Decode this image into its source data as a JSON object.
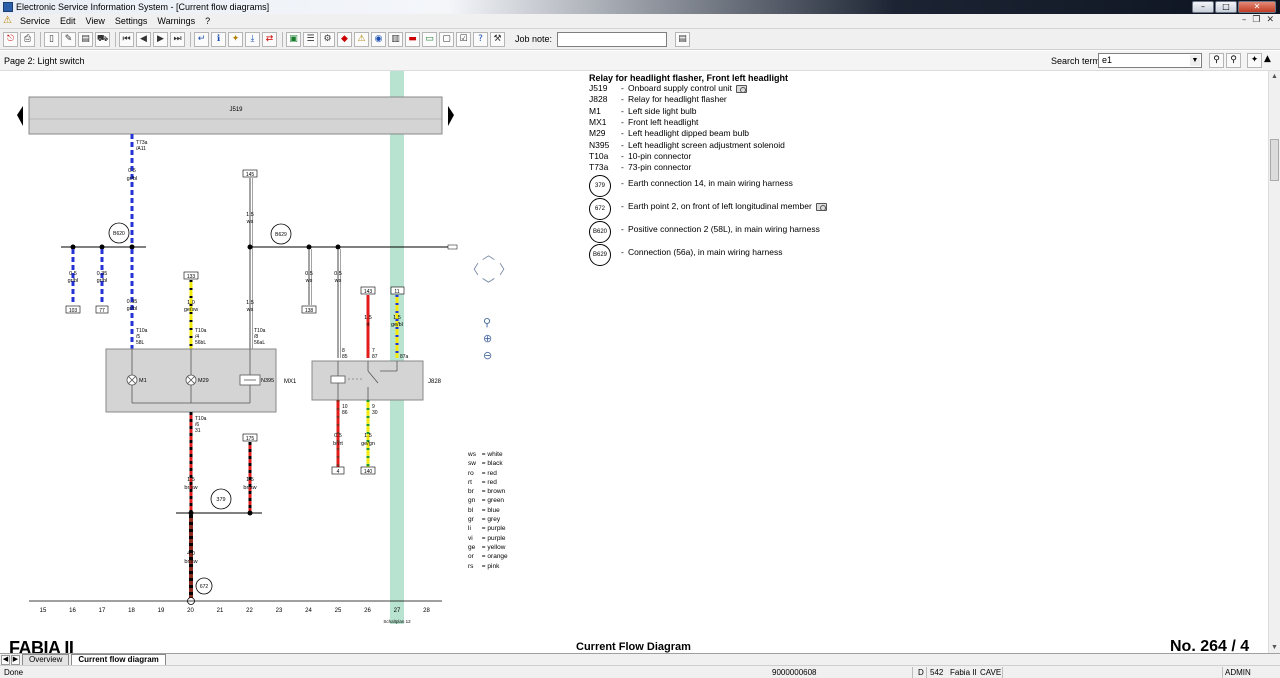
{
  "window": {
    "title": "Electronic Service Information System - [Current flow diagrams]"
  },
  "menu": {
    "items": [
      "Service",
      "Edit",
      "View",
      "Settings",
      "Warnings",
      "?"
    ]
  },
  "toolbar": {
    "job_note_label": "Job note:",
    "job_note_value": ""
  },
  "page": {
    "title": "Page 2: Light switch"
  },
  "search": {
    "label": "Search term:",
    "value": "e1"
  },
  "diagram": {
    "legend_title": "Relay for headlight flasher, Front left headlight",
    "components": [
      {
        "code": "J519",
        "desc": "Onboard supply control unit",
        "camera": true
      },
      {
        "code": "J828",
        "desc": "Relay for headlight flasher",
        "camera": false
      },
      {
        "code": "M1",
        "desc": "Left side light bulb",
        "camera": false
      },
      {
        "code": "MX1",
        "desc": "Front left headlight",
        "camera": false
      },
      {
        "code": "M29",
        "desc": "Left headlight dipped beam bulb",
        "camera": false
      },
      {
        "code": "N395",
        "desc": "Left headlight screen adjustment solenoid",
        "camera": false
      },
      {
        "code": "T10a",
        "desc": "10-pin connector",
        "camera": false
      },
      {
        "code": "T73a",
        "desc": "73-pin connector",
        "camera": false
      }
    ],
    "connections": [
      {
        "code": "379",
        "desc": "Earth connection 14, in main wiring harness",
        "camera": false
      },
      {
        "code": "672",
        "desc": "Earth point 2, on front of left longitudinal member",
        "camera": true
      },
      {
        "code": "B620",
        "desc": "Positive connection 2 (58L), in main wiring harness",
        "camera": false
      },
      {
        "code": "B629",
        "desc": "Connection (56a), in main wiring harness",
        "camera": false
      }
    ],
    "color_key": [
      [
        "ws",
        "white"
      ],
      [
        "sw",
        "black"
      ],
      [
        "ro",
        "red"
      ],
      [
        "rt",
        "red"
      ],
      [
        "br",
        "brown"
      ],
      [
        "gn",
        "green"
      ],
      [
        "bl",
        "blue"
      ],
      [
        "gr",
        "grey"
      ],
      [
        "li",
        "purple"
      ],
      [
        "vi",
        "purple"
      ],
      [
        "ge",
        "yellow"
      ],
      [
        "or",
        "orange"
      ],
      [
        "rs",
        "pink"
      ]
    ],
    "wires": {
      "j519_label": "J519",
      "t73a": "T73a",
      "a11": "/A11",
      "w_t73_size": "0.5",
      "w_t73_color": "gr/bl",
      "b620": "B620",
      "b629": "B629",
      "ref_145": "145",
      "ref_175": "175",
      "ref_133": "133",
      "ref_143": "143",
      "ref_11": "11",
      "ref_138": "138",
      "ref_ext": "300",
      "ref_103": "103",
      "ref_77": "77",
      "ref_4": "4",
      "ref_140": "140",
      "w1_size": "0.5",
      "w1_color": "gr/bl",
      "w2_size": "0.35",
      "w2_color": "gr/bl",
      "w3_size": "0.35",
      "w3_color": "gr/bl",
      "w4_size": "1.0",
      "w4_color": "ge/sw",
      "w5_size": "1.5",
      "w5_color": "ws",
      "w6_size": "1.5",
      "w6_color": "ws",
      "w7_size": "0.5",
      "w7_color": "ws",
      "w8_size": "0.5",
      "w8_color": "ws",
      "w9_size": "1.5",
      "w9_color": "rt",
      "w10_size": "1.5",
      "w10_color": "ge/bl",
      "w11_size": "1.5",
      "w11_color": "br/sw",
      "w12_size": "1.5",
      "w12_color": "br/sw",
      "w13_size": "4.0",
      "w13_color": "br/sw",
      "w14_size": "0.5",
      "w14_color": "br/rt",
      "w15_size": "1.5",
      "w15_color": "ge/gn",
      "t10a_5": "T10a",
      "t10a_5p": "/5",
      "t10a_5s": "58L",
      "t10a_4": "T10a",
      "t10a_4p": "/4",
      "t10a_4s": "56bL",
      "t10a_8": "T10a",
      "t10a_8p": "/8",
      "t10a_8s": "56aL",
      "t10a_6": "T10a",
      "t10a_6p": "/6",
      "t10a_6s": "31",
      "mx1": "MX1",
      "m1": "M1",
      "m29": "M29",
      "n395": "N395",
      "j828": "J828",
      "p85": "8",
      "p85s": "85",
      "p87": "7",
      "p87s": "87",
      "p87a": "87a",
      "p86": "10",
      "p86s": "86",
      "p30": "9",
      "p30s": "30",
      "e379": "379",
      "e672": "672",
      "ref_bottom": "Schaltplan 12"
    },
    "column_numbers": [
      "15",
      "16",
      "17",
      "18",
      "19",
      "20",
      "21",
      "22",
      "23",
      "24",
      "25",
      "26",
      "27",
      "28"
    ]
  },
  "footer": {
    "left": "FABIA II",
    "mid": "Current Flow Diagram",
    "right": "No.  264 / 4"
  },
  "tabs": {
    "items": [
      "Overview",
      "Current flow diagram"
    ]
  },
  "status": {
    "left": "Done",
    "number": "9000000608",
    "s1": "D",
    "s2": "542",
    "s3": "Fabia II",
    "s4": "CAVE",
    "s5": "ADMIN"
  },
  "colors": {
    "highlight_column": "#b9e3d1",
    "wire_blue": "#2433d6",
    "wire_red": "#e21b1b",
    "wire_yellow": "#f2ea0b",
    "wire_green": "#1a9b2f",
    "wire_brown": "#8b2a1d",
    "wire_grey": "#9a9a9a"
  }
}
